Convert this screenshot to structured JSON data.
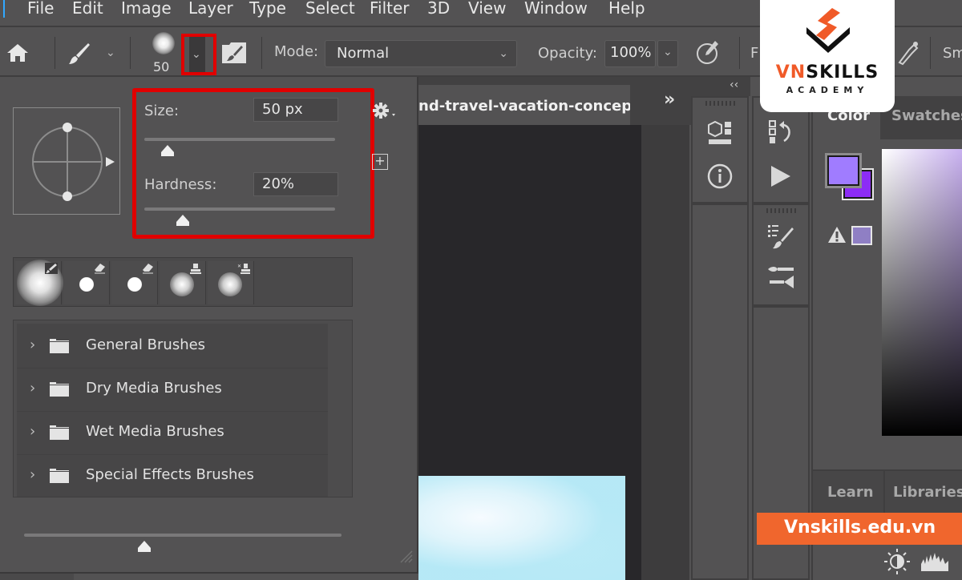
{
  "menu": {
    "items": [
      "File",
      "Edit",
      "Image",
      "Layer",
      "Type",
      "Select",
      "Filter",
      "3D",
      "View",
      "Window",
      "Help"
    ]
  },
  "options_bar": {
    "brush_size": "50",
    "mode_label": "Mode:",
    "mode_value": "Normal",
    "opacity_label": "Opacity:",
    "opacity_value": "100%",
    "flow_label_partial": "F",
    "smoothing_label_partial": "Sm"
  },
  "brush_popup": {
    "size_label": "Size:",
    "size_value": "50 px",
    "size_fraction": 0.12,
    "hardness_label": "Hardness:",
    "hardness_value": "20%",
    "hardness_fraction": 0.2,
    "recent_brushes": [
      {
        "type": "soft-large",
        "badge": "brush-icon"
      },
      {
        "type": "hard-small",
        "badge": "eraser-icon"
      },
      {
        "type": "hard-small",
        "badge": "eraser-icon"
      },
      {
        "type": "soft-medium",
        "badge": "stamp-icon"
      },
      {
        "type": "soft-medium",
        "badge": "clone-stamp-icon"
      }
    ],
    "groups": [
      {
        "name": "General Brushes"
      },
      {
        "name": "Dry Media Brushes"
      },
      {
        "name": "Wet Media Brushes"
      },
      {
        "name": "Special Effects Brushes"
      }
    ],
    "preview_size_fraction": 0.38
  },
  "document": {
    "tab_title": "nd-travel-vacation-concept",
    "overflow_icon": "»"
  },
  "color_panel": {
    "tabs": [
      "Color",
      "Swatches"
    ],
    "active_tab": "Color",
    "foreground_color": "#a07cff",
    "background_color": "#8c2cf5",
    "gamut_color": "#8f7fc4"
  },
  "learn_panel": {
    "tabs": [
      "Learn",
      "Libraries"
    ]
  },
  "branding": {
    "logo_vn": "VN",
    "logo_skills": "SKILLS",
    "logo_sub": "ACADEMY",
    "url": "Vnskills.edu.vn",
    "accent": "#f05a28"
  },
  "colors": {
    "highlight": "#e00000",
    "panel_bg": "#535253",
    "canvas_bg": "#28272a"
  }
}
